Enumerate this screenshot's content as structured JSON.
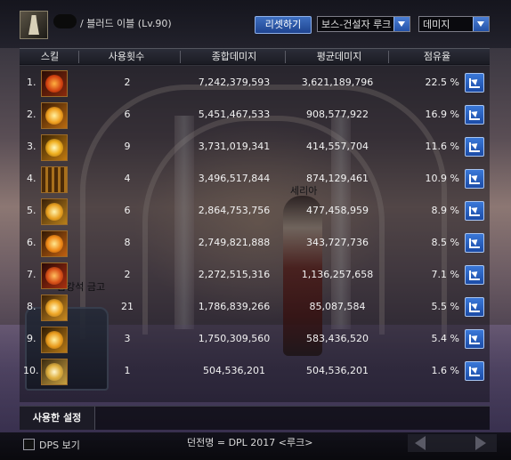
{
  "header": {
    "character_name": "/ 블러드 이블 (Lv.90)",
    "reset_label": "리셋하기",
    "target_select": "보스-건설자 루크",
    "metric_select": "데미지"
  },
  "table": {
    "columns": [
      "스킬",
      "사용횟수",
      "종합데미지",
      "평균데미지",
      "점유율"
    ],
    "rows": [
      {
        "rank": "1.",
        "count": "2",
        "total": "7,242,379,593",
        "avg": "3,621,189,796",
        "share": "22.5 %",
        "icon": "flame-claw-icon"
      },
      {
        "rank": "2.",
        "count": "6",
        "total": "5,451,467,533",
        "avg": "908,577,922",
        "share": "16.9 %",
        "icon": "burst-strike-icon"
      },
      {
        "rank": "3.",
        "count": "9",
        "total": "3,731,019,341",
        "avg": "414,557,704",
        "share": "11.6 %",
        "icon": "explosion-icon"
      },
      {
        "rank": "4.",
        "count": "4",
        "total": "3,496,517,844",
        "avg": "874,129,461",
        "share": "10.9 %",
        "icon": "blood-pillar-icon"
      },
      {
        "rank": "5.",
        "count": "6",
        "total": "2,864,753,756",
        "avg": "477,458,959",
        "share": "8.9 %",
        "icon": "eruption-icon"
      },
      {
        "rank": "6.",
        "count": "8",
        "total": "2,749,821,888",
        "avg": "343,727,736",
        "share": "8.5 %",
        "icon": "fire-blast-icon"
      },
      {
        "rank": "7.",
        "count": "2",
        "total": "2,272,515,316",
        "avg": "1,136,257,658",
        "share": "7.1 %",
        "icon": "blade-rush-icon"
      },
      {
        "rank": "8.",
        "count": "21",
        "total": "1,786,839,266",
        "avg": "85,087,584",
        "share": "5.5 %",
        "icon": "claw-slash-icon"
      },
      {
        "rank": "9.",
        "count": "3",
        "total": "1,750,309,560",
        "avg": "583,436,520",
        "share": "5.4 %",
        "icon": "flame-wave-icon"
      },
      {
        "rank": "10.",
        "count": "1",
        "total": "504,536,201",
        "avg": "504,536,201",
        "share": "1.6 %",
        "icon": "whirl-slash-icon"
      }
    ]
  },
  "scene": {
    "npc_name": "세리아",
    "chest_label": "금강석 금고"
  },
  "settings_tab": "사용한 설정",
  "footer": {
    "dps_label": "DPS 보기",
    "dungeon_text": "던전명 = DPL 2017 <루크>"
  },
  "colors": {
    "accent_blue": "#2f63c4",
    "panel_dark": "#14141c",
    "icon_fire": "#e08a1e"
  }
}
